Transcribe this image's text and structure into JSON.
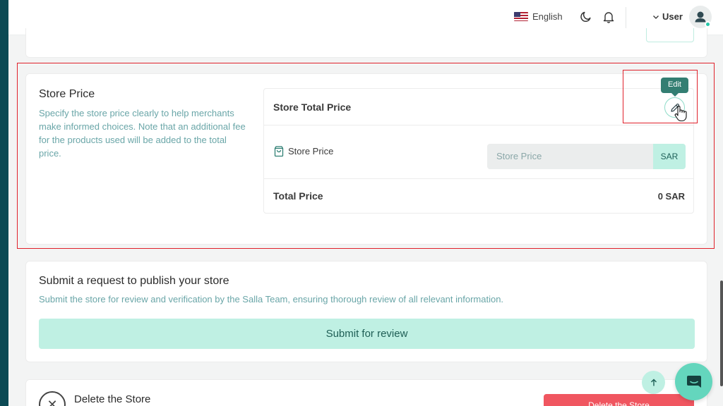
{
  "header": {
    "language": "English",
    "user_label": "User"
  },
  "store_price": {
    "title": "Store Price",
    "description": "Specify the store price clearly to help merchants make informed choices. Note that an additional fee for the products used will be added to the total price.",
    "total_label": "Store Total Price",
    "edit_tooltip": "Edit",
    "field_label": "Store Price",
    "input_placeholder": "Store Price",
    "input_value": "",
    "currency": "SAR",
    "total_price_label": "Total Price",
    "total_price_value": "0 SAR"
  },
  "submit_section": {
    "title": "Submit a request to publish your store",
    "description": "Submit the store for review and verification by the Salla Team, ensuring thorough review of all relevant information.",
    "button": "Submit for review"
  },
  "delete_section": {
    "title": "Delete the Store",
    "button": "Delete the Store"
  },
  "colors": {
    "accent": "#bff0e3",
    "accent_text": "#1e5e55",
    "danger": "#f05660",
    "sidebar": "#0c4a54",
    "highlight": "#e0212b"
  },
  "icons": [
    "moon-icon",
    "bell-icon",
    "chevron-down-icon",
    "user-icon",
    "pencil-icon",
    "bag-icon",
    "arrow-up-icon",
    "chat-icon",
    "close-circle-icon"
  ]
}
